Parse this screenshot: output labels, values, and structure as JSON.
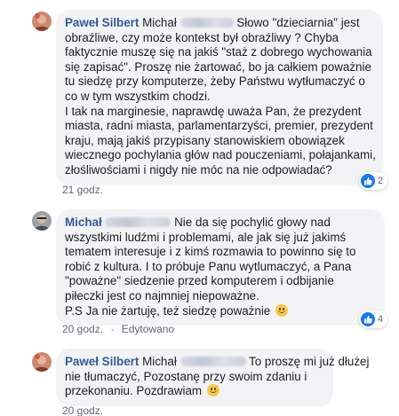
{
  "comments": [
    {
      "author": "Paweł Silbert",
      "lines": [
        "Michał",
        "Słowo \"dzieciarnia\" jest",
        "obraźliwe, czy może kontekst był obraźliwy ? Chyba",
        "faktycznie muszę się na jakiś \"staż z dobrego wychowania",
        "się zapisać\". Proszę nie żartować, bo ja całkiem poważnie",
        "tu siedzę przy komputerze, żeby Państwu wytłumaczyć o",
        "co w tym wszystkim chodzi.",
        "I tak na marginesie, naprawdę uważa Pan, że prezydent",
        "miasta, radni miasta, parlamentarzyści, premier, prezydent",
        "kraju, mają jakiś przypisany stanowiskiem obowiązek",
        "wiecznego pochylania głów nad pouczeniami, połajankami,",
        "złośliwościami i nigdy nie móc na nie odpowiadać?"
      ],
      "reaction_count": "2",
      "time": "21 godz.",
      "edited": ""
    },
    {
      "author": "Michał",
      "lines": [
        "Nie da się pochylić głowy nad",
        "wszystkimi ludźmi i problemami, ale jak się już jakimś",
        "tematem interesuje i z kimś rozmawia to powinno się to",
        "robić z kultura. I to próbuje Panu wytlumaczyć, a Pana",
        "\"poważne\" siedzenie przed komputerem i odbijanie",
        "piłeczki jest co najmniej niepoważne.",
        "P.S Ja nie żartuję, też siedzę poważnie"
      ],
      "reaction_count": "4",
      "time": "20 godz.",
      "edited": "Edytowano"
    },
    {
      "author": "Paweł Silbert",
      "lines": [
        "Michał",
        "To proszę mi już dłużej",
        "nie tłumaczyć, Pozostanę przy swoim zdaniu i",
        "przekonaniu. Pozdrawiam"
      ],
      "reaction_count": "",
      "time": "20 godz.",
      "edited": ""
    }
  ],
  "meta_separator": "·",
  "colors": {
    "author": "#385898",
    "bubble": "#f2f3f5",
    "like": "#1877f2",
    "meta": "#606770"
  }
}
